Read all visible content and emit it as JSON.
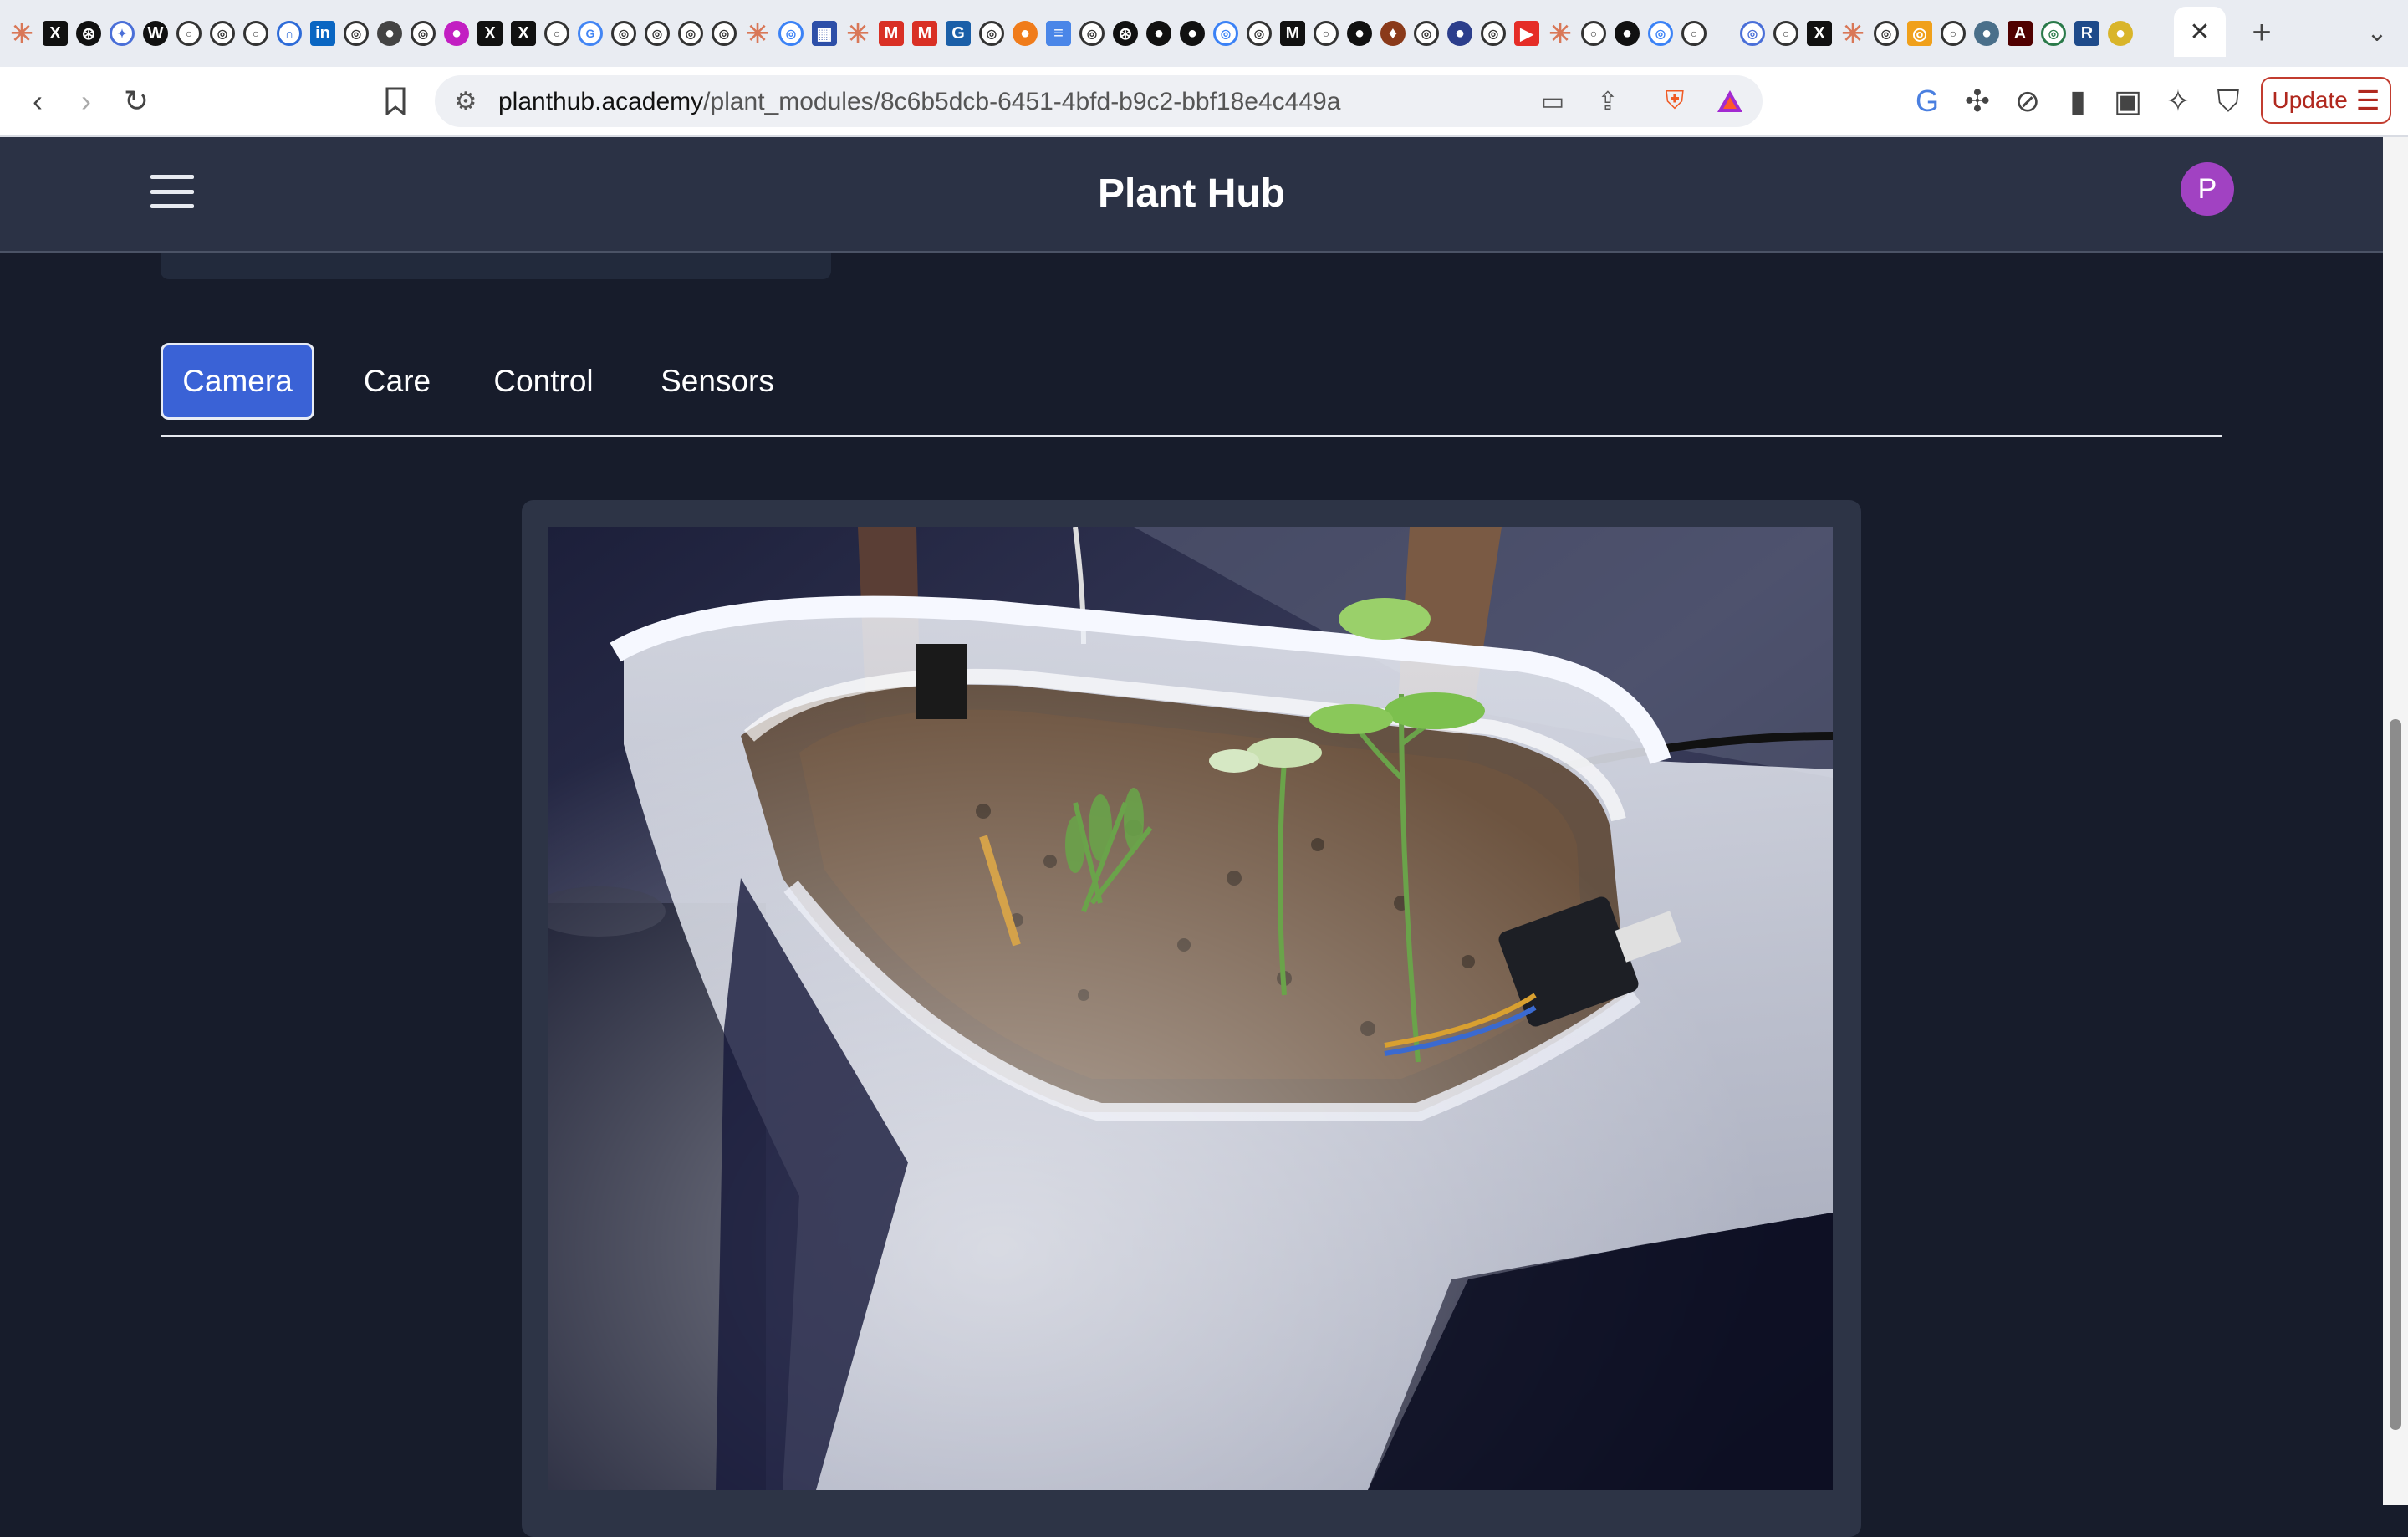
{
  "browser": {
    "url_host": "planthub.academy",
    "url_path": "/plant_modules/8c6b5dcb-6451-4bfd-b9c2-bbf18e4c449a",
    "update_label": "Update",
    "tab_icons": [
      {
        "name": "claude-icon",
        "glyph": "✳",
        "style": "claude",
        "color": "#d97757"
      },
      {
        "name": "x-icon",
        "glyph": "X",
        "style": "dark sq",
        "color": "#111111"
      },
      {
        "name": "openai-icon",
        "glyph": "⊛",
        "style": "dark",
        "color": "#111111"
      },
      {
        "name": "ai-icon",
        "glyph": "✦",
        "style": "ring",
        "color": "#4a6fd8"
      },
      {
        "name": "wordpress-icon",
        "glyph": "W",
        "style": "dark",
        "color": "#111111"
      },
      {
        "name": "github-icon",
        "glyph": "○",
        "style": "ring",
        "color": "#333333"
      },
      {
        "name": "generic-site-icon",
        "glyph": "◎",
        "style": "ring",
        "color": "#333333"
      },
      {
        "name": "github-icon",
        "glyph": "○",
        "style": "ring",
        "color": "#333333"
      },
      {
        "name": "arc-icon",
        "glyph": "∩",
        "style": "ring",
        "color": "#2d6bd8"
      },
      {
        "name": "linkedin-icon",
        "glyph": "in",
        "style": "sq",
        "color": "#0a66c2"
      },
      {
        "name": "generic-site-icon",
        "glyph": "◎",
        "style": "ring",
        "color": "#333333"
      },
      {
        "name": "globe-icon",
        "glyph": "●",
        "style": "dark",
        "color": "#444444"
      },
      {
        "name": "generic-site-icon",
        "glyph": "◎",
        "style": "ring",
        "color": "#333333"
      },
      {
        "name": "purple-site-icon",
        "glyph": "●",
        "style": "",
        "color": "#c21fc2"
      },
      {
        "name": "x-icon",
        "glyph": "X",
        "style": "dark sq",
        "color": "#111111"
      },
      {
        "name": "x-icon",
        "glyph": "X",
        "style": "dark sq",
        "color": "#111111"
      },
      {
        "name": "github-icon",
        "glyph": "○",
        "style": "ring",
        "color": "#333333"
      },
      {
        "name": "google-icon",
        "glyph": "G",
        "style": "ring",
        "color": "#4285f4"
      },
      {
        "name": "generic-site-icon",
        "glyph": "◎",
        "style": "ring",
        "color": "#333333"
      },
      {
        "name": "generic-site-icon",
        "glyph": "◎",
        "style": "ring",
        "color": "#333333"
      },
      {
        "name": "generic-site-icon",
        "glyph": "◎",
        "style": "ring",
        "color": "#333333"
      },
      {
        "name": "generic-site-icon",
        "glyph": "◎",
        "style": "ring",
        "color": "#333333"
      },
      {
        "name": "claude-icon",
        "glyph": "✳",
        "style": "claude",
        "color": "#d97757"
      },
      {
        "name": "generic-site-icon",
        "glyph": "◎",
        "style": "ring",
        "color": "#3b82f6"
      },
      {
        "name": "generic-site-icon",
        "glyph": "▦",
        "style": "sq",
        "color": "#2d4fa8"
      },
      {
        "name": "claude-icon",
        "glyph": "✳",
        "style": "claude",
        "color": "#d97757"
      },
      {
        "name": "gmail-icon",
        "glyph": "M",
        "style": "sq",
        "color": "#d93025"
      },
      {
        "name": "gmail-icon",
        "glyph": "M",
        "style": "sq",
        "color": "#d93025"
      },
      {
        "name": "generic-site-icon",
        "glyph": "G",
        "style": "sq",
        "color": "#1b5fa8"
      },
      {
        "name": "generic-site-icon",
        "glyph": "◎",
        "style": "ring",
        "color": "#333333"
      },
      {
        "name": "orange-site-icon",
        "glyph": "●",
        "style": "",
        "color": "#f07c1b"
      },
      {
        "name": "docs-icon",
        "glyph": "≡",
        "style": "sq",
        "color": "#4a86e8"
      },
      {
        "name": "generic-site-icon",
        "glyph": "◎",
        "style": "ring",
        "color": "#333333"
      },
      {
        "name": "openai-icon",
        "glyph": "⊛",
        "style": "dark",
        "color": "#111111"
      },
      {
        "name": "github-icon",
        "glyph": "●",
        "style": "dark",
        "color": "#111111"
      },
      {
        "name": "github-icon",
        "glyph": "●",
        "style": "dark",
        "color": "#111111"
      },
      {
        "name": "generic-site-icon",
        "glyph": "◎",
        "style": "ring",
        "color": "#3b82f6"
      },
      {
        "name": "generic-site-icon",
        "glyph": "◎",
        "style": "ring",
        "color": "#333333"
      },
      {
        "name": "medium-icon",
        "glyph": "M",
        "style": "dark sq",
        "color": "#111111"
      },
      {
        "name": "github-icon",
        "glyph": "○",
        "style": "ring",
        "color": "#333333"
      },
      {
        "name": "github-icon",
        "glyph": "●",
        "style": "dark",
        "color": "#111111"
      },
      {
        "name": "shield-site-icon",
        "glyph": "♦",
        "style": "",
        "color": "#8a3a1a"
      },
      {
        "name": "generic-site-icon",
        "glyph": "◎",
        "style": "ring",
        "color": "#333333"
      },
      {
        "name": "generic-site-icon",
        "glyph": "●",
        "style": "",
        "color": "#2c3e8c"
      },
      {
        "name": "generic-site-icon",
        "glyph": "◎",
        "style": "ring",
        "color": "#333333"
      },
      {
        "name": "youtube-icon",
        "glyph": "▶",
        "style": "sq",
        "color": "#e52d27"
      },
      {
        "name": "claude-icon",
        "glyph": "✳",
        "style": "claude",
        "color": "#d97757"
      },
      {
        "name": "github-icon",
        "glyph": "○",
        "style": "ring",
        "color": "#333333"
      },
      {
        "name": "github-icon",
        "glyph": "●",
        "style": "dark",
        "color": "#111111"
      },
      {
        "name": "generic-site-icon",
        "glyph": "◎",
        "style": "ring",
        "color": "#3b82f6"
      },
      {
        "name": "github-icon",
        "glyph": "○",
        "style": "ring",
        "color": "#333333"
      },
      {
        "name": "spacer",
        "glyph": "",
        "style": "spacer",
        "color": "transparent"
      },
      {
        "name": "generic-site-icon",
        "glyph": "◎",
        "style": "ring",
        "color": "#4a6fd8"
      },
      {
        "name": "github-icon",
        "glyph": "○",
        "style": "ring",
        "color": "#333333"
      },
      {
        "name": "x-icon",
        "glyph": "X",
        "style": "dark sq",
        "color": "#111111"
      },
      {
        "name": "claude-icon",
        "glyph": "✳",
        "style": "claude",
        "color": "#d97757"
      },
      {
        "name": "generic-site-icon",
        "glyph": "◎",
        "style": "ring",
        "color": "#333333"
      },
      {
        "name": "orange-site-icon",
        "glyph": "◎",
        "style": "sq",
        "color": "#f0a01b"
      },
      {
        "name": "github-icon",
        "glyph": "○",
        "style": "ring",
        "color": "#333333"
      },
      {
        "name": "generic-site-icon",
        "glyph": "●",
        "style": "",
        "color": "#4a6f8a"
      },
      {
        "name": "tamu-icon",
        "glyph": "A",
        "style": "sq",
        "color": "#500000"
      },
      {
        "name": "generic-site-icon",
        "glyph": "◎",
        "style": "ring",
        "color": "#2a7a4a"
      },
      {
        "name": "r-icon",
        "glyph": "R",
        "style": "sq",
        "color": "#1e4a8a"
      },
      {
        "name": "generic-site-icon",
        "glyph": "●",
        "style": "",
        "color": "#d9b52a"
      }
    ],
    "active_tab_close": "✕",
    "new_tab": "+",
    "tab_list": "⌄"
  },
  "app": {
    "title": "Plant Hub",
    "avatar_initial": "P",
    "tabs": [
      {
        "label": "Camera",
        "active": true
      },
      {
        "label": "Care",
        "active": false
      },
      {
        "label": "Control",
        "active": false
      },
      {
        "label": "Sensors",
        "active": false
      }
    ]
  },
  "colors": {
    "page_bg": "#171c2b",
    "header_bg": "#2b3245",
    "active_tab": "#3a62d6",
    "avatar": "#a142c2"
  }
}
